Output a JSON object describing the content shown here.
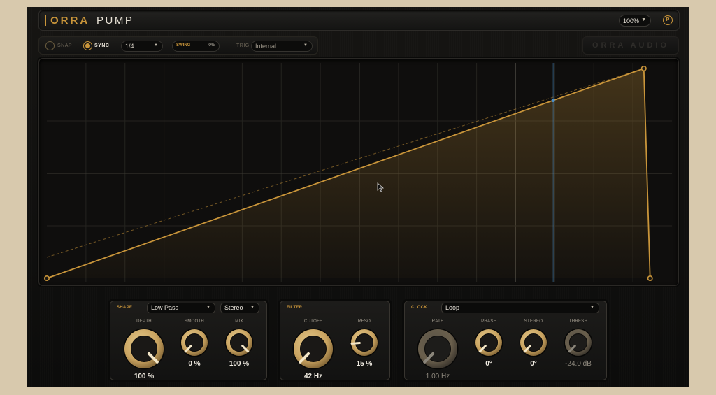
{
  "header": {
    "brand": "ORRA",
    "product": "PUMP",
    "zoom": "100%"
  },
  "toolbar": {
    "snap_label": "SNAP",
    "snap_on": false,
    "sync_label": "SYNC",
    "sync_on": true,
    "division": "1/4",
    "swing_label": "SWING",
    "swing_value": "0%",
    "trig_label": "TRIG",
    "trig_value": "Internal"
  },
  "brand_badge": "ORRA AUDIO",
  "editor": {
    "grid_columns": 16,
    "grid_rows": 4,
    "points": [
      {
        "x": 0.0,
        "y": 0.0
      },
      {
        "x": 0.955,
        "y": 1.0
      },
      {
        "x": 0.965,
        "y": 0.0
      }
    ],
    "playhead": 0.81,
    "colors": {
      "curve": "#c9953a",
      "playhead": "#4b8fc9"
    }
  },
  "panels": {
    "shape": {
      "title": "SHAPE",
      "filter_type": "Low Pass",
      "channel_mode": "Stereo",
      "knobs": [
        {
          "label": "DEPTH",
          "value": "100 %",
          "fraction": 1.0
        },
        {
          "label": "SMOOTH",
          "value": "0 %",
          "fraction": 0.0
        },
        {
          "label": "MIX",
          "value": "100 %",
          "fraction": 1.0
        }
      ]
    },
    "filter": {
      "title": "FILTER",
      "knobs": [
        {
          "label": "CUTOFF",
          "value": "42 Hz",
          "fraction": 0.0
        },
        {
          "label": "RESO",
          "value": "15 %",
          "fraction": 0.15
        }
      ]
    },
    "clock": {
      "title": "CLOCK",
      "mode": "Loop",
      "knobs": [
        {
          "label": "RATE",
          "value": "1.00 Hz",
          "fraction": 0.0,
          "disabled": true
        },
        {
          "label": "PHASE",
          "value": "0°",
          "fraction": 0.0
        },
        {
          "label": "STEREO",
          "value": "0°",
          "fraction": 0.0
        },
        {
          "label": "THRESH",
          "value": "-24.0 dB",
          "fraction": 0.0,
          "disabled": true
        }
      ]
    }
  }
}
